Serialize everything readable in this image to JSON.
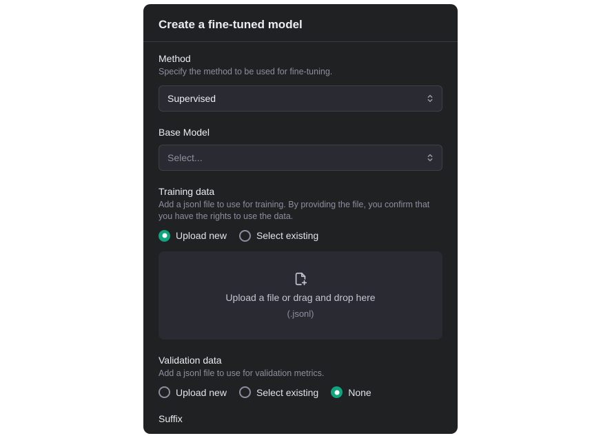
{
  "header": {
    "title": "Create a fine-tuned model"
  },
  "method": {
    "label": "Method",
    "desc": "Specify the method to be used for fine-tuning.",
    "value": "Supervised"
  },
  "baseModel": {
    "label": "Base Model",
    "placeholder": "Select..."
  },
  "training": {
    "label": "Training data",
    "desc": "Add a jsonl file to use for training. By providing the file, you confirm that you have the rights to use the data.",
    "options": {
      "upload": "Upload new",
      "existing": "Select existing"
    },
    "selected": "upload",
    "dropzone": {
      "text": "Upload a file or drag and drop here",
      "sub": "(.jsonl)"
    }
  },
  "validation": {
    "label": "Validation data",
    "desc": "Add a jsonl file to use for validation metrics.",
    "options": {
      "upload": "Upload new",
      "existing": "Select existing",
      "none": "None"
    },
    "selected": "none"
  },
  "suffix": {
    "label": "Suffix"
  }
}
